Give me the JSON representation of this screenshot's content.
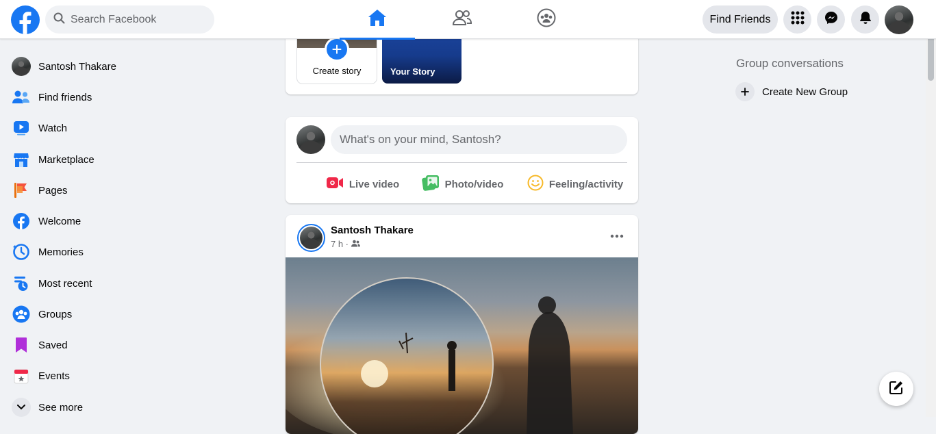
{
  "topbar": {
    "search_placeholder": "Search Facebook",
    "find_friends_label": "Find Friends",
    "nav_tabs": [
      "home",
      "friends",
      "groups"
    ],
    "active_tab": "home"
  },
  "sidebar": {
    "items": [
      {
        "label": "Santosh Thakare",
        "icon": "profile-avatar"
      },
      {
        "label": "Find friends",
        "icon": "friends-icon"
      },
      {
        "label": "Watch",
        "icon": "watch-icon"
      },
      {
        "label": "Marketplace",
        "icon": "marketplace-icon"
      },
      {
        "label": "Pages",
        "icon": "pages-flag-icon"
      },
      {
        "label": "Welcome",
        "icon": "facebook-icon"
      },
      {
        "label": "Memories",
        "icon": "memories-clock-icon"
      },
      {
        "label": "Most recent",
        "icon": "most-recent-icon"
      },
      {
        "label": "Groups",
        "icon": "groups-icon"
      },
      {
        "label": "Saved",
        "icon": "bookmark-icon"
      },
      {
        "label": "Events",
        "icon": "calendar-icon"
      },
      {
        "label": "See more",
        "icon": "chevron-down-icon"
      }
    ]
  },
  "stories": {
    "create_label": "Create story",
    "your_story_label": "Your Story"
  },
  "composer": {
    "placeholder": "What's on your mind, Santosh?",
    "live_video": "Live video",
    "photo_video": "Photo/video",
    "feeling": "Feeling/activity"
  },
  "post": {
    "author": "Santosh Thakare",
    "time": "7 h ·",
    "audience_icon": "friends-audience-icon"
  },
  "right": {
    "group_heading": "Group conversations",
    "create_group": "Create New Group"
  },
  "colors": {
    "brand": "#1877f2",
    "background": "#f0f2f5",
    "secondary_text": "#65676b"
  }
}
